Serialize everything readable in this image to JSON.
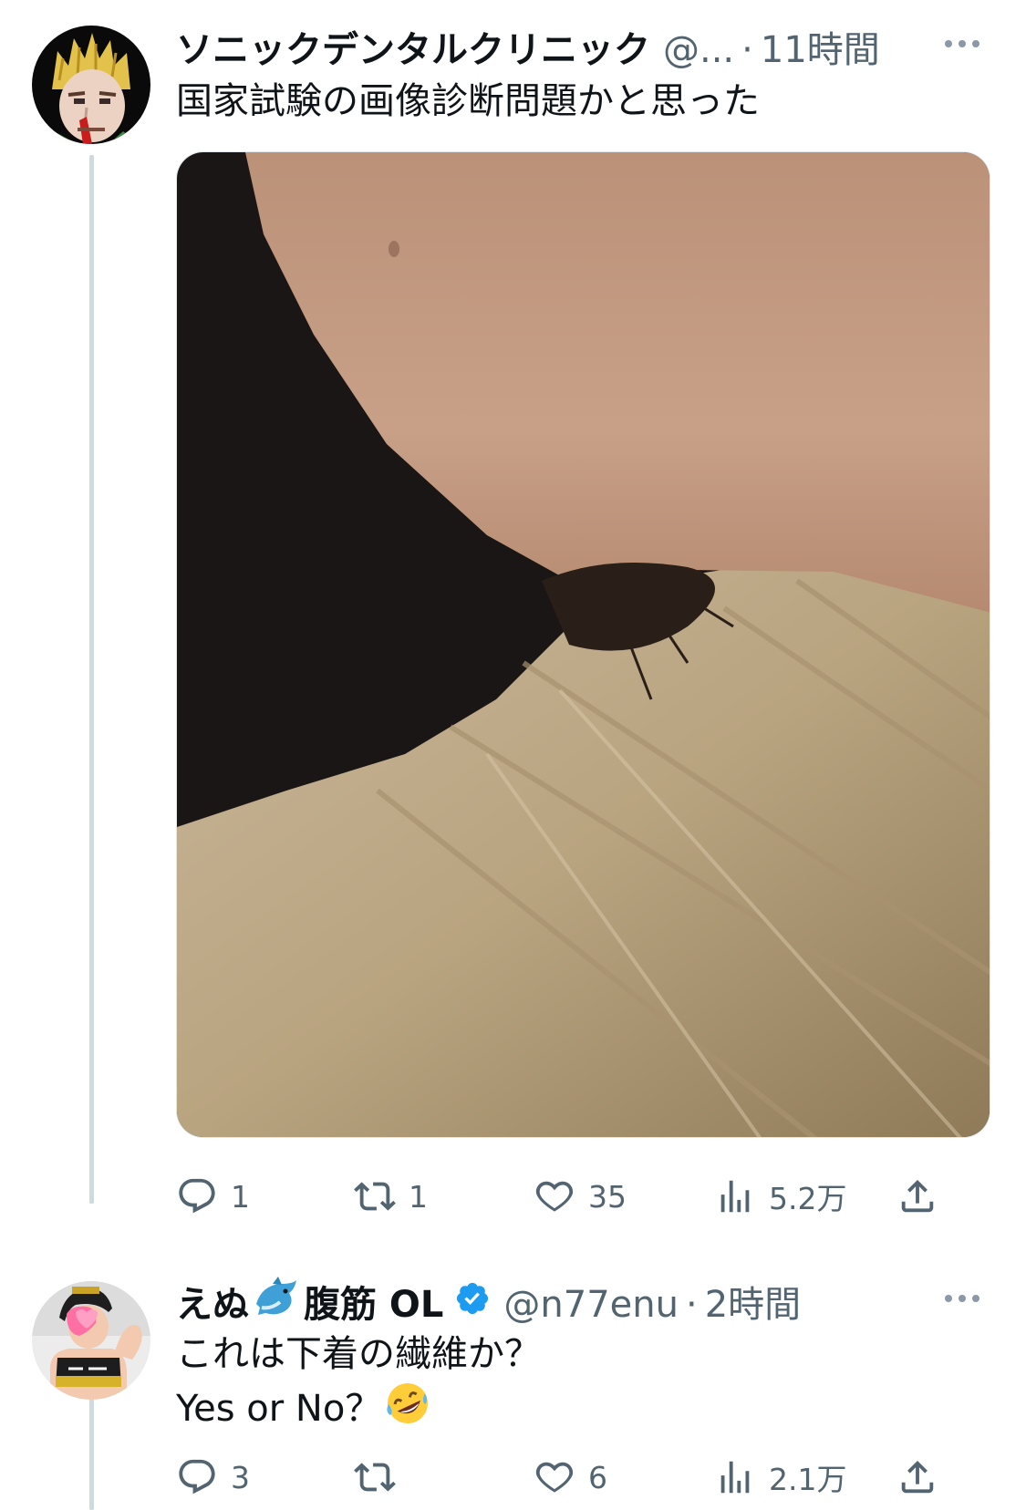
{
  "tweet1": {
    "display_name": "ソニックデンタルクリニック",
    "handle": "@...",
    "separator": "·",
    "time": "11時間",
    "text": "国家試験の画像診断問題かと思った",
    "avatar_icon": "character-portrait-avatar",
    "actions": {
      "reply_count": "1",
      "retweet_count": "1",
      "like_count": "35",
      "views_count": "5.2万"
    }
  },
  "tweet2": {
    "display_name_part1": "えぬ",
    "display_name_emoji": "dolphin-emoji",
    "display_name_part2": "腹筋 OL",
    "verified_icon": "verified-badge-icon",
    "handle": "@n77enu",
    "separator": "·",
    "time": "2時間",
    "text_line1": "これは下着の繊維か？",
    "text_line2": "Yes or No？",
    "text_emoji": "rofl-emoji",
    "avatar_icon": "fitness-person-avatar",
    "actions": {
      "reply_count": "3",
      "retweet_count": "",
      "like_count": "6",
      "views_count": "2.1万"
    }
  },
  "colors": {
    "text_primary": "#0f1419",
    "text_secondary": "#536471",
    "thread_line": "#cfd9de",
    "verified_blue": "#1d9bf0"
  }
}
